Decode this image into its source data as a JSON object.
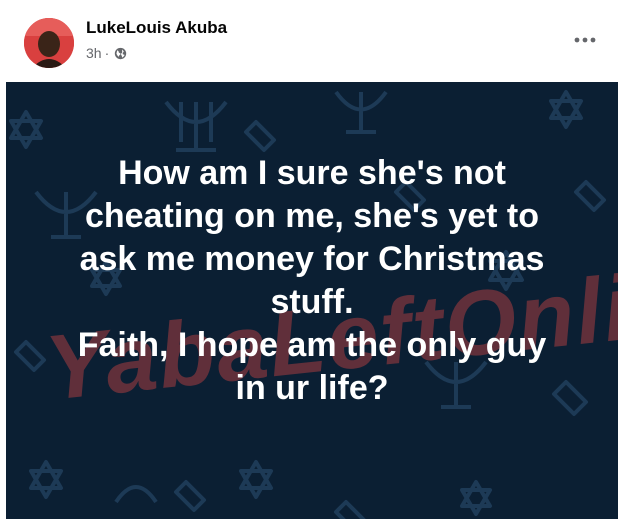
{
  "post": {
    "author": "LukeLouis Akuba",
    "timestamp": "3h",
    "separator": "·",
    "privacy_icon": "globe-icon",
    "more_icon": "more-options-icon"
  },
  "image": {
    "lines": [
      "How am I sure she's not",
      "cheating on me, she's yet to",
      "ask me money for Christmas",
      "stuff.",
      "Faith, I hope am the only guy",
      "in ur life?"
    ],
    "watermark": "YabaLeftOnline",
    "background_color": "#0b1f33",
    "watermark_color": "#d64646"
  }
}
